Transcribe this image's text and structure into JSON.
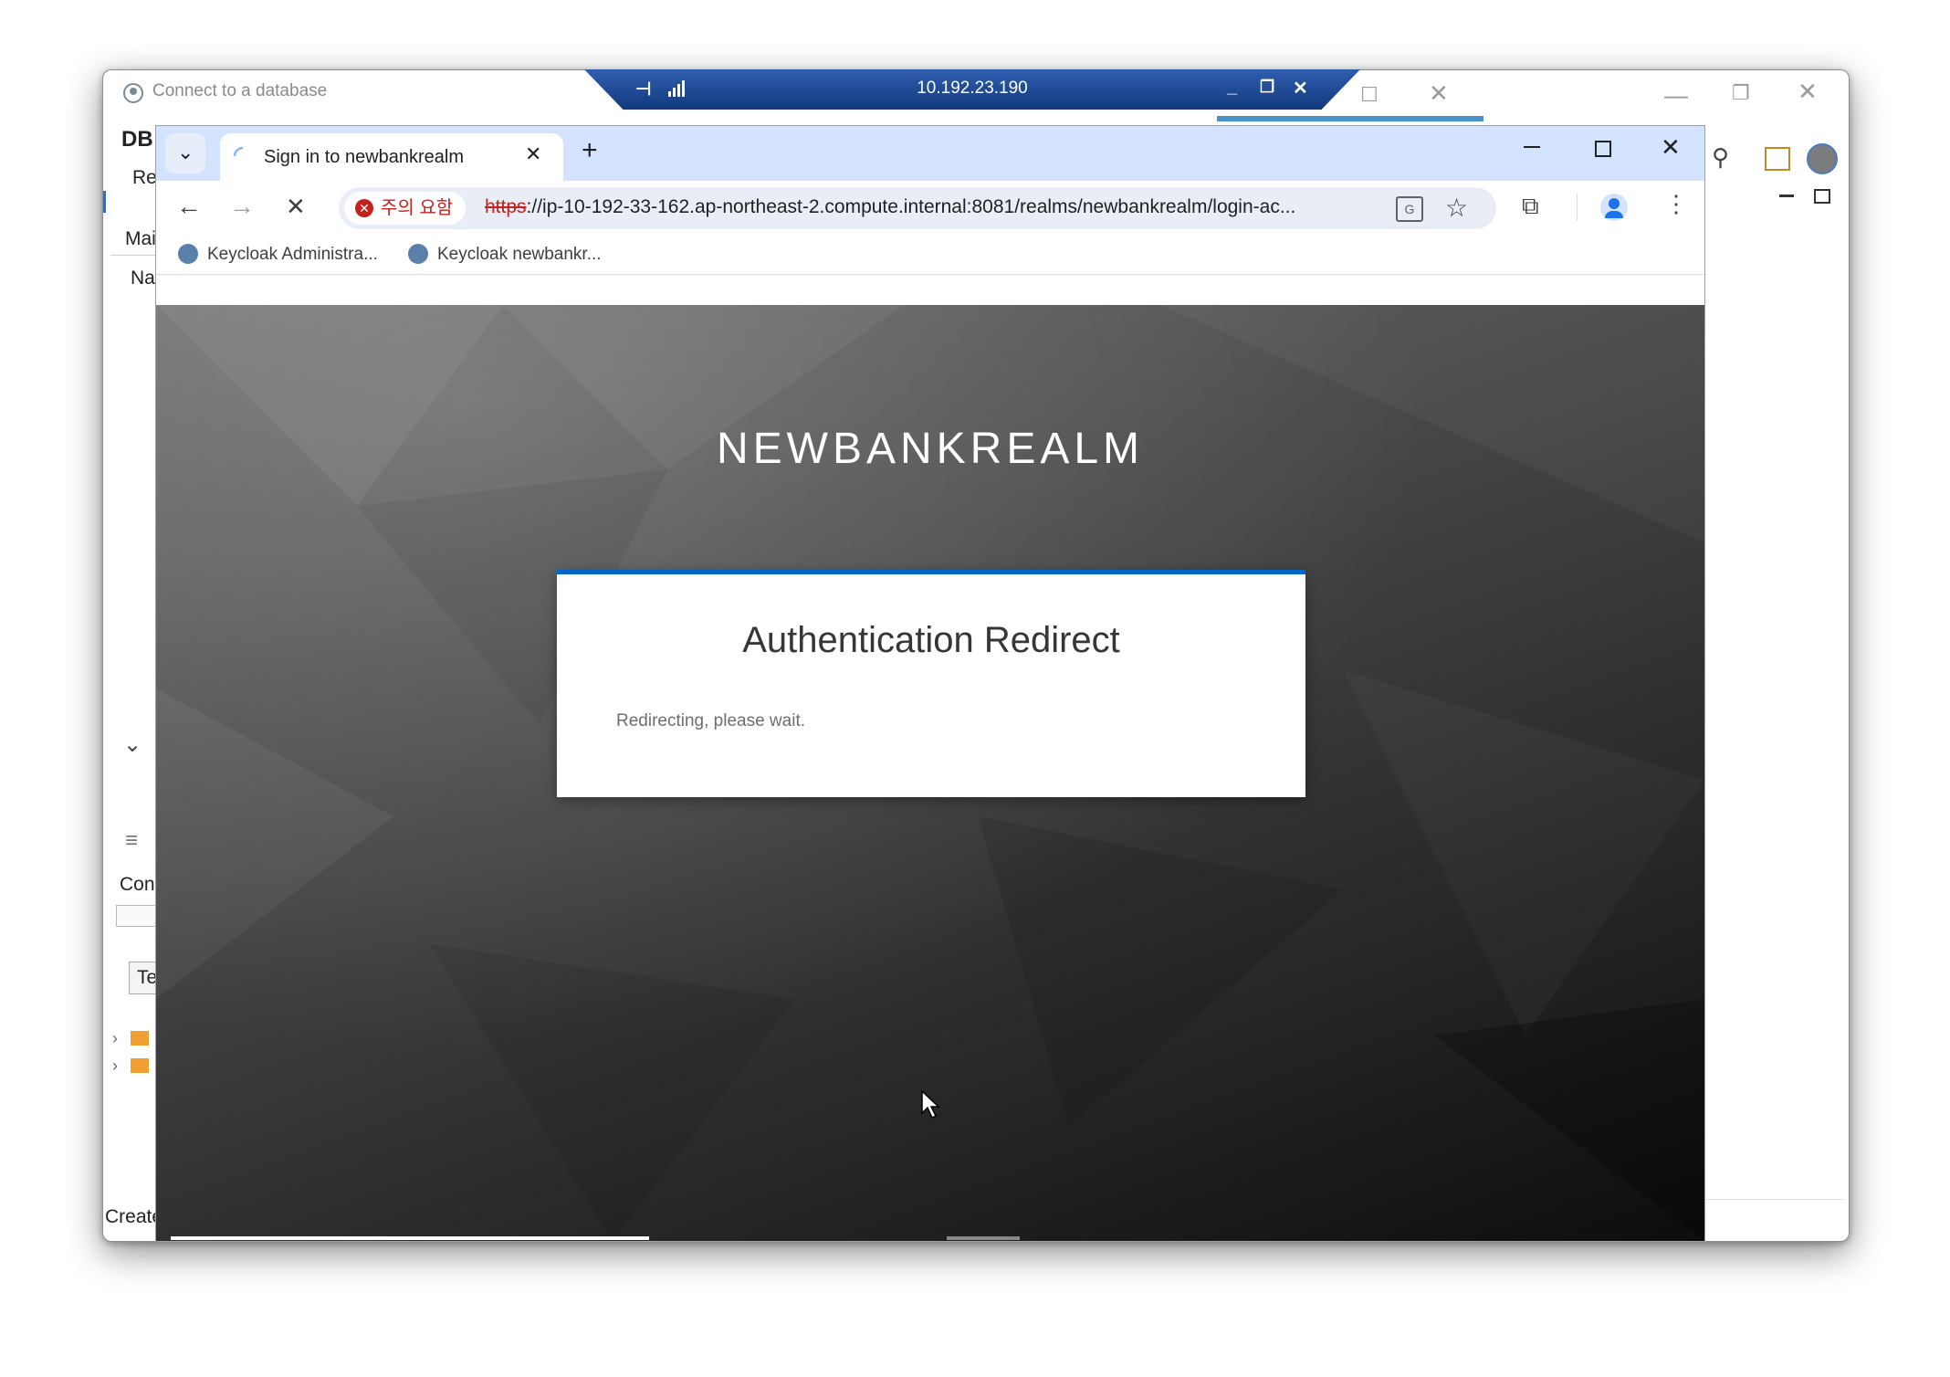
{
  "outer_window": {
    "title": "Connect to a database",
    "left_labels": [
      "DB",
      "Re",
      "Mai",
      "Na",
      "Con",
      "Te",
      "Create"
    ]
  },
  "rdp": {
    "ip": "10.192.23.190"
  },
  "chrome": {
    "tab_title": "Sign in to newbankrealm",
    "security_label": "주의 요함",
    "url_scheme": "https",
    "url_rest": "://ip-10-192-33-162.ap-northeast-2.compute.internal:8081/realms/newbankrealm/login-ac...",
    "bookmarks": [
      "Keycloak Administra...",
      "Keycloak newbankr..."
    ]
  },
  "page": {
    "realm_title": "NEWBANKREALM",
    "card_title": "Authentication Redirect",
    "card_message": "Redirecting, please wait."
  },
  "colors": {
    "tabstrip": "#d3e3fd",
    "card_accent": "#0066cc",
    "rdp_bar": "#1d4690",
    "not_secure": "#c5221f"
  }
}
